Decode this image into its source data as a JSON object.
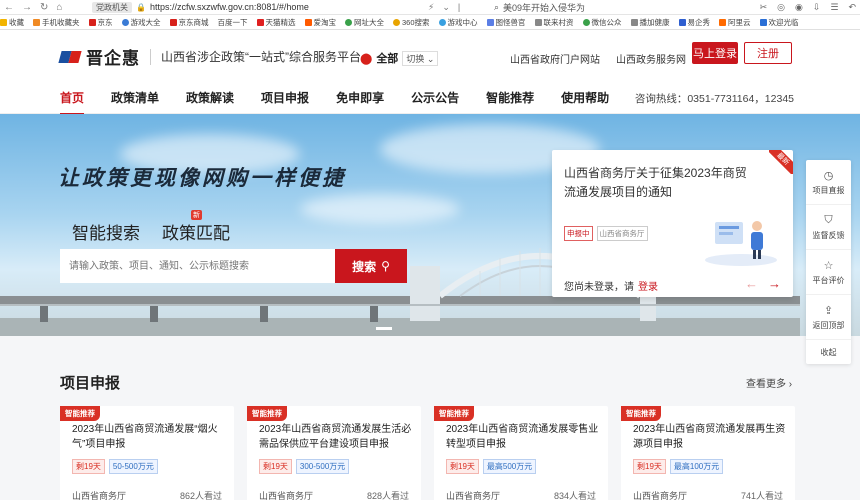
{
  "browser": {
    "tab_label": "党政机关",
    "url": "https://zcfw.sxzwfw.gov.cn:8081/#/home",
    "search_text": "美09年开始入侵华为",
    "bookmarks": [
      "收藏",
      "手机收藏夹",
      "京东",
      "游戏大全",
      "京东商城",
      "百度一下",
      "天猫精选",
      "爱淘宝",
      "网址大全",
      "360搜索",
      "游戏中心",
      "图怪兽官",
      "联来村资",
      "微信公众",
      "播加健康",
      "易企秀",
      "阿里云",
      "欢迎光临"
    ]
  },
  "header": {
    "logo_text": "晋企惠",
    "platform_title": "山西省涉企政策“一站式”综合服务平台",
    "location": "全部",
    "switch_label": "切换",
    "links": [
      "山西省政府门户网站",
      "山西政务服务网"
    ],
    "login_label": "马上登录",
    "register_label": "注册"
  },
  "nav": {
    "items": [
      "首页",
      "政策清单",
      "政策解读",
      "项目申报",
      "免申即享",
      "公示公告",
      "智能推荐",
      "使用帮助"
    ],
    "hotline": "咨询热线：0351-7731164，12345"
  },
  "hero": {
    "slogan": "让政策更现像网购一样便捷",
    "tabs": [
      "智能搜索",
      "政策匹配"
    ],
    "new_tag": "新",
    "search_placeholder": "请输入政策、项目、通知、公示标题搜索",
    "search_button": "搜索"
  },
  "notice": {
    "corner": "最新",
    "title": "山西省商务厅关于征集2023年商贸流通发展项目的通知",
    "status_tag": "申报中",
    "org_tag": "山西省商务厅",
    "login_prompt": "您尚未登录，请",
    "login_link": "登录"
  },
  "rail": {
    "items": [
      "项目直报",
      "监督反馈",
      "平台评价",
      "返回顶部"
    ],
    "collapse": "收起"
  },
  "projects": {
    "title": "项目申报",
    "more": "查看更多",
    "cards": [
      {
        "badge": "智能推荐",
        "title": "2023年山西省商贸流通发展“烟火气”项目申报",
        "days": "剩19天",
        "amount": "50-500万元",
        "org": "山西省商务厅",
        "views": "862人看过"
      },
      {
        "badge": "智能推荐",
        "title": "2023年山西省商贸流通发展生活必需品保供应平台建设项目申报",
        "days": "剩19天",
        "amount": "300-500万元",
        "org": "山西省商务厅",
        "views": "828人看过"
      },
      {
        "badge": "智能推荐",
        "title": "2023年山西省商贸流通发展零售业转型项目申报",
        "days": "剩19天",
        "amount": "最高500万元",
        "org": "山西省商务厅",
        "views": "834人看过"
      },
      {
        "badge": "智能推荐",
        "title": "2023年山西省商贸流通发展再生资源项目申报",
        "days": "剩19天",
        "amount": "最高100万元",
        "org": "山西省商务厅",
        "views": "741人看过"
      }
    ]
  }
}
